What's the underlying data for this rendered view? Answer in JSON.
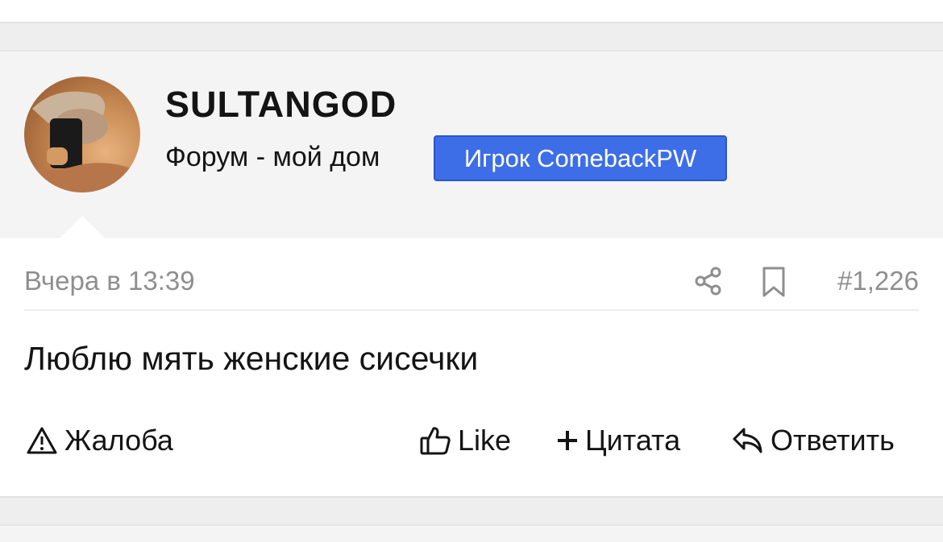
{
  "post": {
    "author": {
      "username": "SULTANGOD",
      "title": "Форум - мой дом",
      "badge": "Игрок ComebackPW",
      "avatar_icon": "user-avatar-photo"
    },
    "date": "Вчера в 13:39",
    "number": "#1,226",
    "body": "Люблю мять женские сисечки",
    "actions": {
      "report": "Жалоба",
      "like": "Like",
      "quote": "Цитата",
      "reply": "Ответить"
    }
  },
  "icons": {
    "share": "share-icon",
    "bookmark": "bookmark-icon",
    "report": "warning-triangle-icon",
    "like": "thumbs-up-icon",
    "quote": "plus-icon",
    "reply": "reply-arrow-icon"
  },
  "colors": {
    "badge_background": "#3d6ee8",
    "muted_text": "#8e8e8e",
    "user_block_background": "#f4f4f4",
    "page_background": "#eeeeee"
  }
}
